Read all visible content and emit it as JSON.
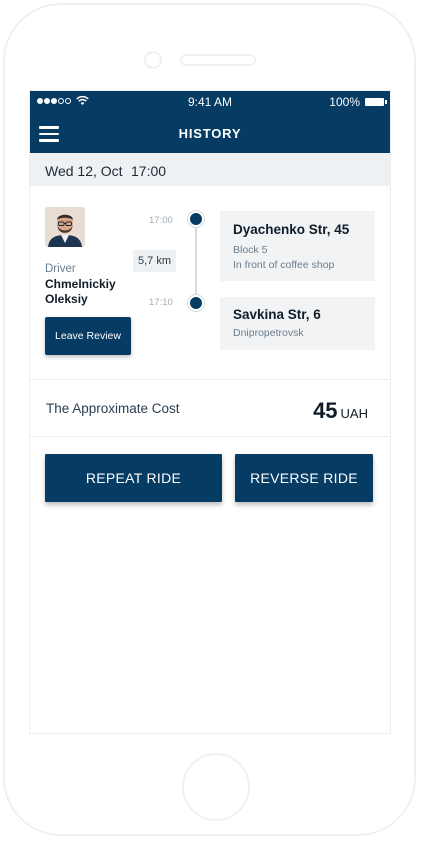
{
  "status_bar": {
    "time": "9:41 AM",
    "battery": "100%"
  },
  "header": {
    "title": "HISTORY"
  },
  "trip": {
    "date": "Wed 12, Oct",
    "time": "17:00",
    "driver": {
      "label": "Driver",
      "first_line": "Chmelnickiy",
      "second_line": "Oleksiy"
    },
    "review_label": "Leave Review",
    "distance": "5,7 km",
    "pickup": {
      "time": "17:00",
      "title": "Dyachenko Str, 45",
      "line1": "Block 5",
      "line2": "In front of coffee shop"
    },
    "dropoff": {
      "time": "17:10",
      "title": "Savkina Str, 6",
      "line1": "Dnipropetrovsk"
    }
  },
  "cost": {
    "label": "The Approximate Cost",
    "value": "45",
    "currency": "UAH"
  },
  "actions": {
    "repeat_label": "REPEAT RIDE",
    "reverse_label": "REVERSE RIDE"
  },
  "colors": {
    "primary": "#063b63",
    "panel": "#eef1f3"
  }
}
